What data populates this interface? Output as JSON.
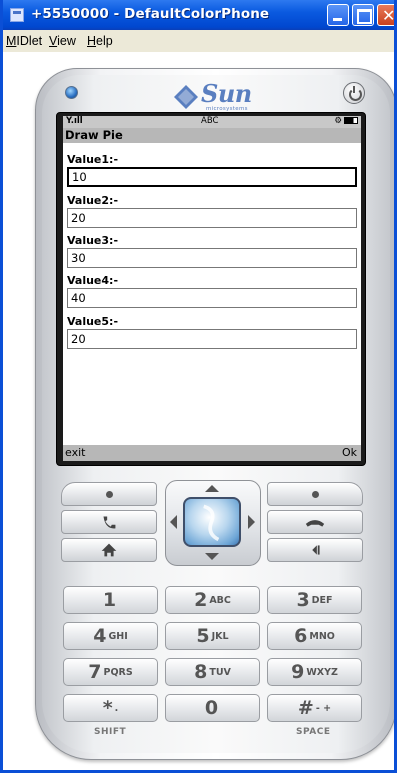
{
  "window": {
    "title": "+5550000 - DefaultColorPhone",
    "menus": [
      {
        "first": "M",
        "rest": "IDlet"
      },
      {
        "first": "V",
        "rest": "iew"
      },
      {
        "first": "H",
        "rest": "elp"
      }
    ]
  },
  "phone": {
    "brand": "Sun",
    "brand_sub": "microsystems",
    "status": {
      "signal": "Y.ıll",
      "input_mode": "ABC"
    },
    "screen_title": "Draw Pie",
    "fields": [
      {
        "label": "Value1:-",
        "value": "10"
      },
      {
        "label": "Value2:-",
        "value": "20"
      },
      {
        "label": "Value3:-",
        "value": "30"
      },
      {
        "label": "Value4:-",
        "value": "40"
      },
      {
        "label": "Value5:-",
        "value": "20"
      }
    ],
    "softkeys": {
      "left": "exit",
      "right": "Ok"
    },
    "keypad": [
      {
        "num": "1",
        "letters": ""
      },
      {
        "num": "2",
        "letters": "ABC"
      },
      {
        "num": "3",
        "letters": "DEF"
      },
      {
        "num": "4",
        "letters": "GHI"
      },
      {
        "num": "5",
        "letters": "JKL"
      },
      {
        "num": "6",
        "letters": "MNO"
      },
      {
        "num": "7",
        "letters": "PQRS"
      },
      {
        "num": "8",
        "letters": "TUV"
      },
      {
        "num": "9",
        "letters": "WXYZ"
      },
      {
        "num": "*",
        "letters": "."
      },
      {
        "num": "0",
        "letters": ""
      },
      {
        "num": "#",
        "letters": "- +"
      }
    ],
    "bottom_labels": {
      "left": "SHIFT",
      "right": "SPACE"
    }
  }
}
